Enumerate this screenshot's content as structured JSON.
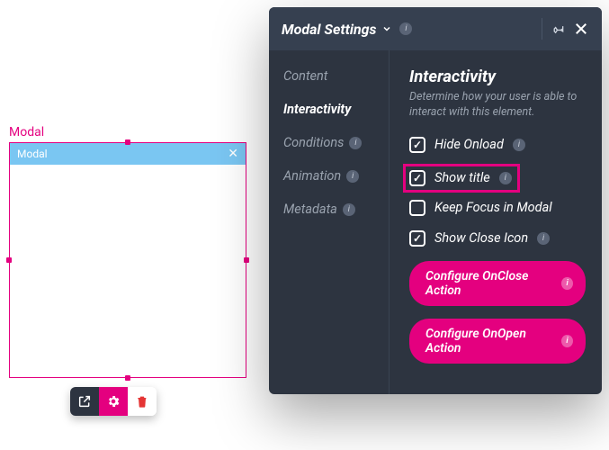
{
  "canvas": {
    "label": "Modal",
    "titlebar_text": "Modal"
  },
  "toolbar_icons": {
    "open": "open-external-icon",
    "settings": "gear-icon",
    "delete": "trash-icon"
  },
  "panel": {
    "title": "Modal Settings",
    "nav": [
      {
        "label": "Content",
        "active": false,
        "info": false
      },
      {
        "label": "Interactivity",
        "active": true,
        "info": false
      },
      {
        "label": "Conditions",
        "active": false,
        "info": true
      },
      {
        "label": "Animation",
        "active": false,
        "info": true
      },
      {
        "label": "Metadata",
        "active": false,
        "info": true
      }
    ],
    "section": {
      "title": "Interactivity",
      "description": "Determine how your user is able to interact with this element.",
      "options": [
        {
          "label": "Hide Onload",
          "checked": true,
          "info": true,
          "highlighted": false
        },
        {
          "label": "Show title",
          "checked": true,
          "info": true,
          "highlighted": true
        },
        {
          "label": "Keep Focus in Modal",
          "checked": false,
          "info": false,
          "highlighted": false
        },
        {
          "label": "Show Close Icon",
          "checked": true,
          "info": true,
          "highlighted": false
        }
      ],
      "actions": [
        {
          "label": "Configure OnClose Action"
        },
        {
          "label": "Configure OnOpen Action"
        }
      ]
    }
  }
}
